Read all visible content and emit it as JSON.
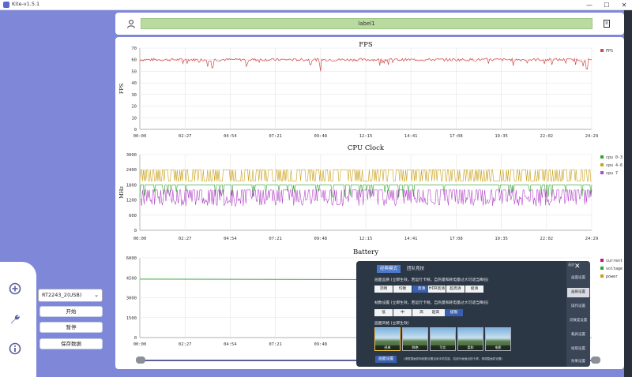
{
  "window": {
    "title": "Kite-v1.5.1",
    "minimize": "—",
    "maximize": "☐",
    "close": "✕"
  },
  "header": {
    "label": "label1"
  },
  "device": {
    "selected": "RT2243_2(USB)"
  },
  "controls": {
    "start": "开始",
    "pause": "暂停",
    "save": "保存数据"
  },
  "time_ticks": [
    "00:00",
    "02:27",
    "04:54",
    "07:21",
    "09:48",
    "12:15",
    "14:41",
    "17:08",
    "19:35",
    "22:02",
    "24:29"
  ],
  "battery_ticks": [
    "00:00",
    "02:27",
    "04:54",
    "07:21",
    "09:48"
  ],
  "chart_data": [
    {
      "type": "line",
      "title": "FPS",
      "ylabel": "FPS",
      "ylim": [
        0,
        70
      ],
      "yticks": [
        "0",
        "10",
        "20",
        "30",
        "40",
        "50",
        "60",
        "70"
      ],
      "series": [
        {
          "name": "FPS",
          "color": "#d24a4a",
          "level": 60,
          "noise": 2.5,
          "dips": [
            [
              0.15,
              54
            ],
            [
              0.16,
              53
            ],
            [
              0.4,
              50
            ],
            [
              0.99,
              52
            ]
          ]
        }
      ],
      "legend": "right"
    },
    {
      "type": "line",
      "title": "CPU Clock",
      "ylabel": "MHz",
      "ylim": [
        0,
        3000
      ],
      "yticks": [
        "0",
        "600",
        "1200",
        "1800",
        "2400",
        "3000"
      ],
      "series": [
        {
          "name": "cpu 0-3",
          "color": "#2aa52a",
          "level": 1800
        },
        {
          "name": "cpu 4-6",
          "color": "#c9a11c",
          "level": 2100,
          "high": 2400
        },
        {
          "name": "cpu 7",
          "color": "#b347c9",
          "level": 1300,
          "high": 1600
        }
      ],
      "legend": "right"
    },
    {
      "type": "line",
      "title": "Battery",
      "ylim": [
        0,
        6000
      ],
      "yticks": [
        "0",
        "1500",
        "3000",
        "4500",
        "6000"
      ],
      "series": [
        {
          "name": "current",
          "color": "#c4157a"
        },
        {
          "name": "voltage",
          "color": "#2aa52a",
          "level": 4400
        },
        {
          "name": "power",
          "color": "#c99a1c"
        }
      ],
      "legend": "right"
    }
  ],
  "game_overlay": {
    "tabs": [
      "经典模式",
      "团队竞技"
    ],
    "menu_title": "画质",
    "menu": [
      "画面设置",
      "画质设置",
      "操作设置",
      "灵敏度设置",
      "载具设置",
      "拾取设置",
      "效果设置"
    ],
    "quality_label": "画面品质 (立即生效，若运行卡顿，自热量和耗电量过大可适当降低)",
    "quality_options": [
      "流畅",
      "均衡",
      "高清",
      "HDR高清",
      "超高清",
      "极清"
    ],
    "fps_label": "帧数设置 (立即生效，若运行卡顿，自热量和耗电量过大可适当降低)",
    "fps_options": [
      "低",
      "中",
      "高",
      "超高",
      "极限"
    ],
    "style_label": "画面风格 (立即生效)",
    "styles": [
      "经典",
      "鲜艳",
      "写实",
      "柔和",
      "电影"
    ],
    "bottom_button": "画面设置",
    "note": "(请根据画质和帧数设置自身手机性能，若部分画面出现卡顿，请调整画质设置)"
  }
}
